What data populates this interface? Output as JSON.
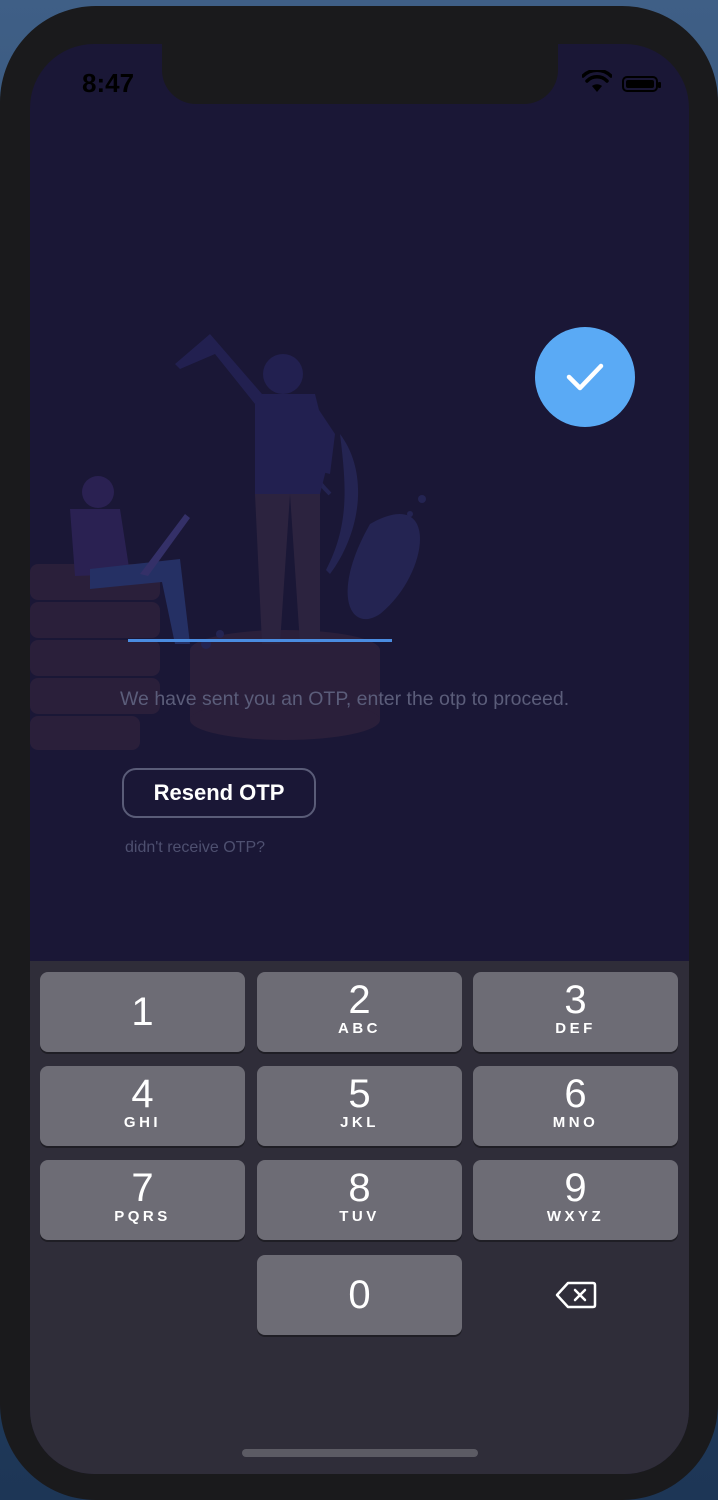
{
  "status_bar": {
    "time": "8:47"
  },
  "otp": {
    "value": "",
    "message": "We have sent you an OTP, enter the otp to proceed.",
    "resend_label": "Resend OTP",
    "didnt_receive": "didn't receive OTP?"
  },
  "keypad": {
    "keys": [
      {
        "digit": "1",
        "letters": ""
      },
      {
        "digit": "2",
        "letters": "ABC"
      },
      {
        "digit": "3",
        "letters": "DEF"
      },
      {
        "digit": "4",
        "letters": "GHI"
      },
      {
        "digit": "5",
        "letters": "JKL"
      },
      {
        "digit": "6",
        "letters": "MNO"
      },
      {
        "digit": "7",
        "letters": "PQRS"
      },
      {
        "digit": "8",
        "letters": "TUV"
      },
      {
        "digit": "9",
        "letters": "WXYZ"
      },
      {
        "digit": "0",
        "letters": ""
      }
    ],
    "delete_icon": "backspace-icon"
  },
  "colors": {
    "background": "#1a1736",
    "accent": "#5aaaf5",
    "keypad_bg": "#2f2d39",
    "key_bg": "#6d6c75"
  }
}
